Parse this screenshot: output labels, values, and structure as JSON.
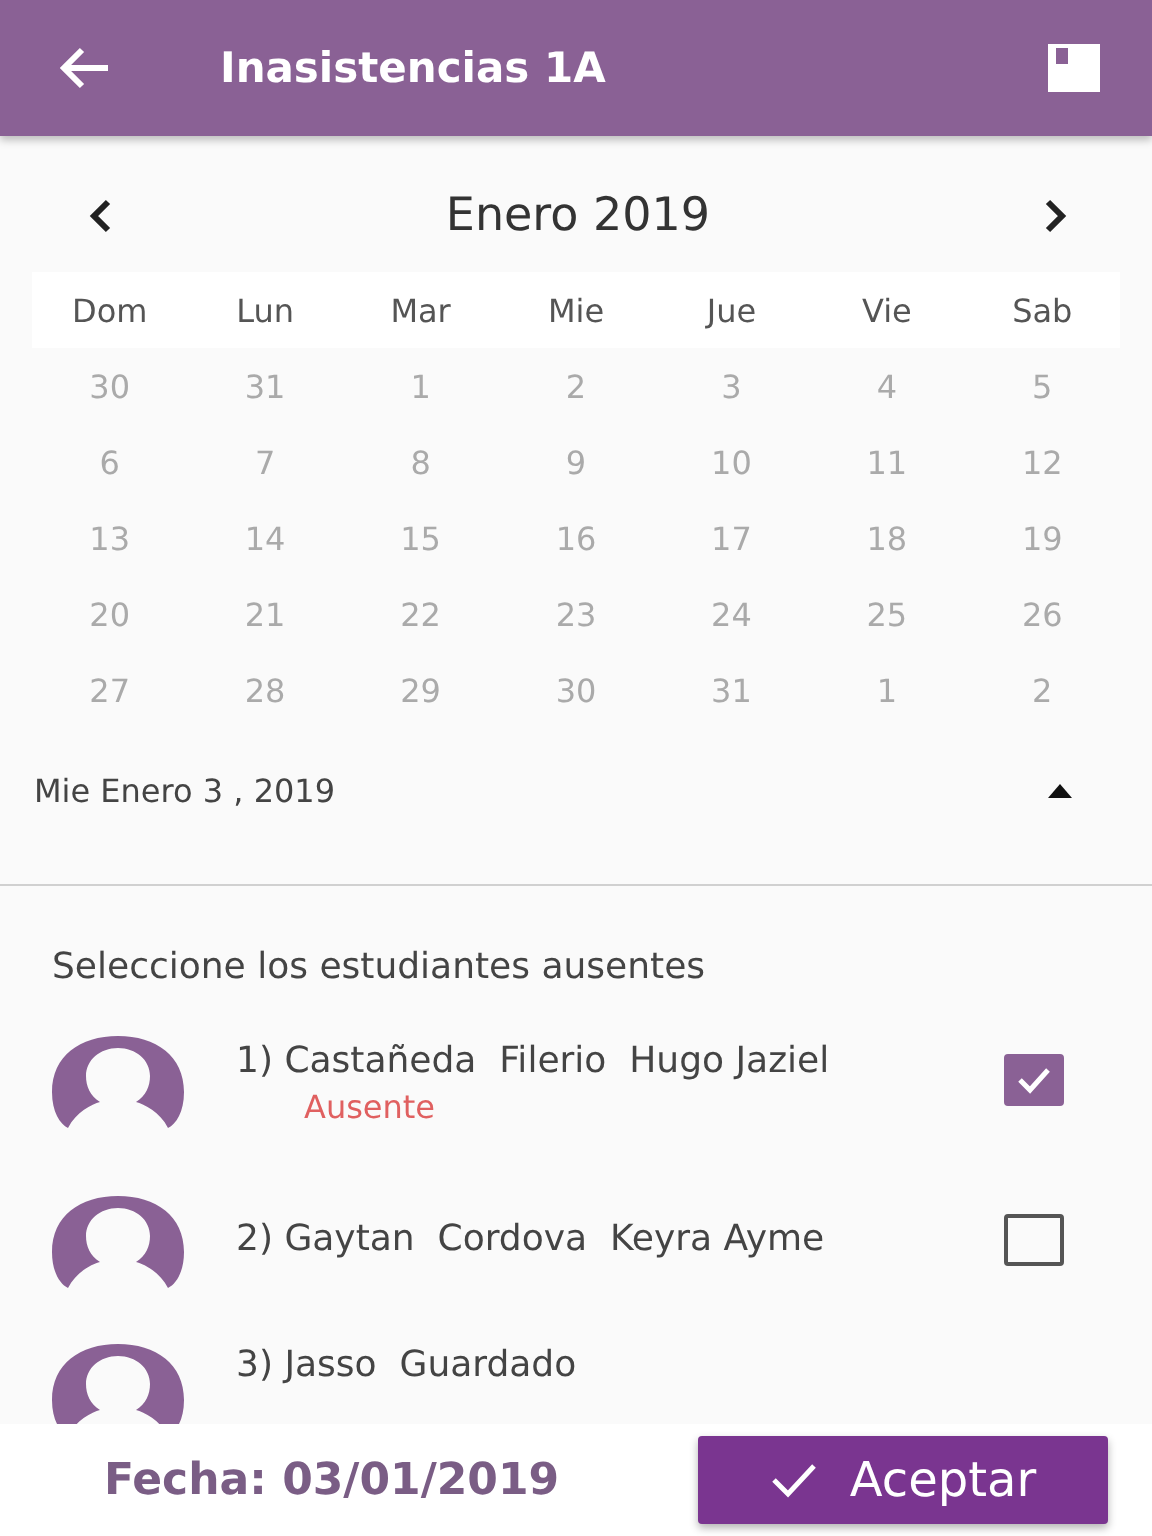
{
  "app_bar": {
    "title": "Inasistencias 1A"
  },
  "calendar": {
    "month": "Enero 2019",
    "weekdays": [
      "Dom",
      "Lun",
      "Mar",
      "Mie",
      "Jue",
      "Vie",
      "Sab"
    ],
    "weeks": [
      [
        "30",
        "31",
        "1",
        "2",
        "3",
        "4",
        "5"
      ],
      [
        "6",
        "7",
        "8",
        "9",
        "10",
        "11",
        "12"
      ],
      [
        "13",
        "14",
        "15",
        "16",
        "17",
        "18",
        "19"
      ],
      [
        "20",
        "21",
        "22",
        "23",
        "24",
        "25",
        "26"
      ],
      [
        "27",
        "28",
        "29",
        "30",
        "31",
        "1",
        "2"
      ]
    ],
    "selected_date": "Mie Enero 3 , 2019",
    "expanded": true
  },
  "section_title": "Seleccione los estudiantes ausentes",
  "students": [
    {
      "name": "1) Castañeda  Filerio  Hugo Jaziel",
      "status": "Ausente",
      "checked": true
    },
    {
      "name": "2) Gaytan  Cordova  Keyra Ayme",
      "checked": false
    },
    {
      "name": "3) Jasso  Guardado"
    }
  ],
  "footer": {
    "date": "Fecha: 03/01/2019",
    "button": "Aceptar"
  }
}
